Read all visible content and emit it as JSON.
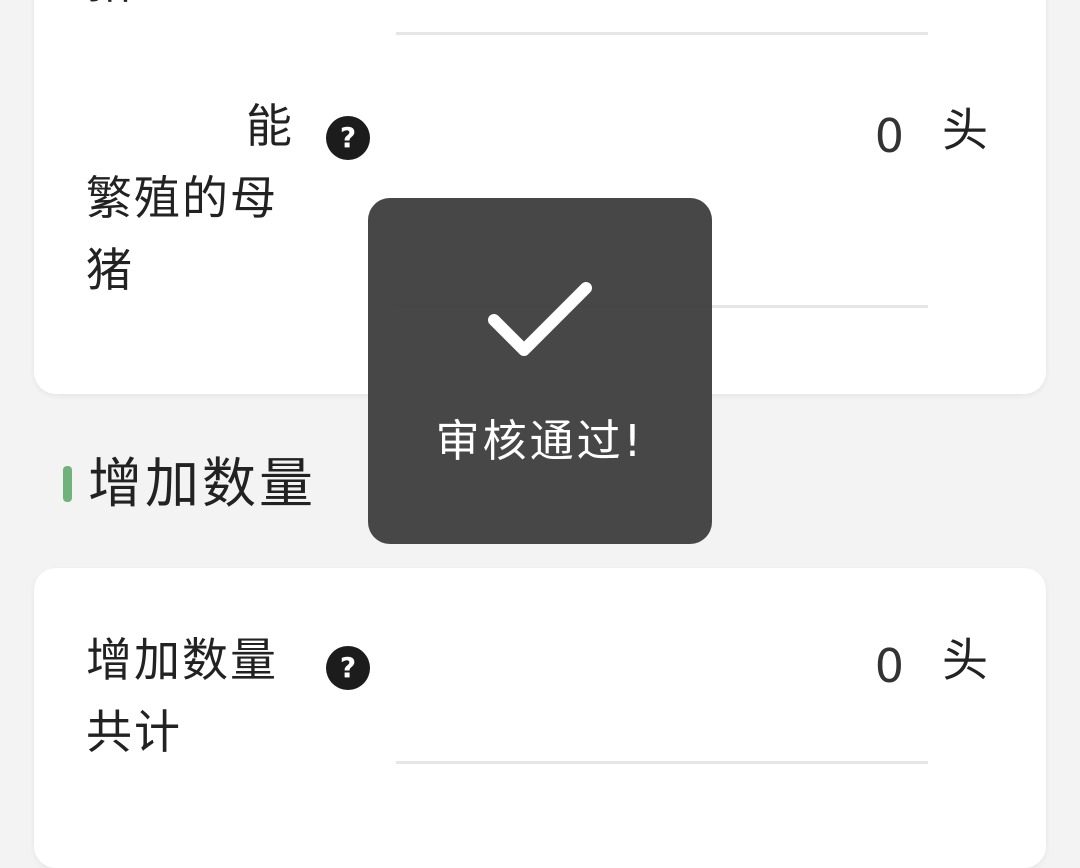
{
  "top_card": {
    "prev_label_tail": "猪",
    "field_label_line1": "能",
    "field_label_line2": "繁殖的母",
    "field_label_line3": "猪",
    "help_icon_glyph": "?",
    "value": "0",
    "unit": "头"
  },
  "section": {
    "title": "增加数量",
    "accent_color": "#6fb27a"
  },
  "bottom_card": {
    "field_label_line1": "增加数量",
    "field_label_line2": "共计",
    "help_icon_glyph": "?",
    "value": "0",
    "unit": "头"
  },
  "toast": {
    "icon": "check-icon",
    "message": "审核通过!"
  }
}
